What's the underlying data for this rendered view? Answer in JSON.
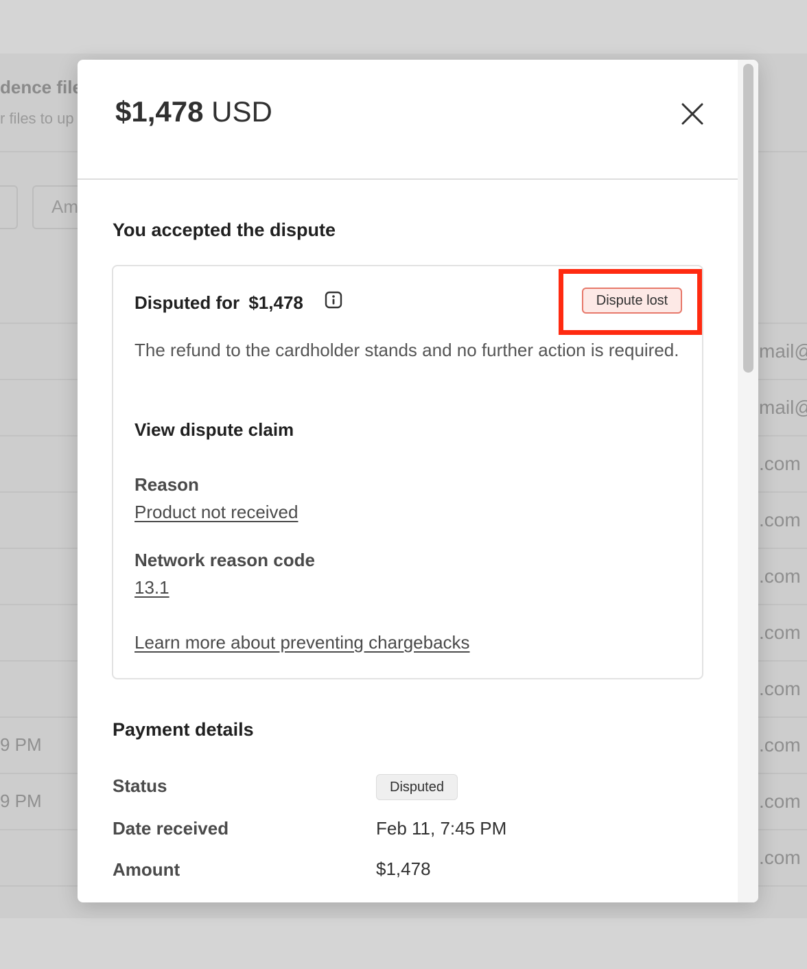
{
  "background": {
    "header_title": "dence file",
    "header_subtitle": "r files to up",
    "filter_input_text": "Am",
    "right_column": [
      "mail@",
      "mail@",
      ".com",
      ".com",
      ".com",
      ".com",
      ".com",
      ".com",
      ".com",
      ".com"
    ],
    "left_column": [
      "9 PM",
      "9 PM"
    ]
  },
  "modal": {
    "amount": "$1,478",
    "currency": "USD",
    "close_icon": "close-icon"
  },
  "dispute": {
    "heading": "You accepted the dispute",
    "disputed_for_label": "Disputed for",
    "disputed_for_amount": "$1,478",
    "info_icon": "info-icon",
    "status_badge": "Dispute lost",
    "status_color": "#e7786a",
    "highlight_color": "#ff2a10",
    "description": "The refund to the cardholder stands and no further action is required.",
    "view_claim": "View dispute claim",
    "reason_label": "Reason",
    "reason_value": "Product not received",
    "network_code_label": "Network reason code",
    "network_code_value": "13.1",
    "learn_more": "Learn more about preventing chargebacks"
  },
  "payment_details": {
    "heading": "Payment details",
    "status_label": "Status",
    "status_value": "Disputed",
    "date_label": "Date received",
    "date_value": "Feb 11, 7:45 PM",
    "amount_label": "Amount",
    "amount_value": "$1,478"
  }
}
